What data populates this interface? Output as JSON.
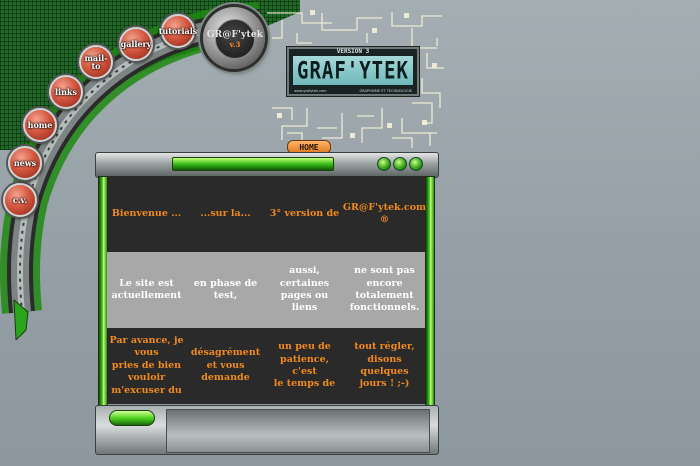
{
  "nav": {
    "buttons": [
      {
        "id": "cv",
        "label": "c.v."
      },
      {
        "id": "news",
        "label": "news"
      },
      {
        "id": "home",
        "label": "home"
      },
      {
        "id": "links",
        "label": "links"
      },
      {
        "id": "mailto",
        "label": "mail-to"
      },
      {
        "id": "gallery",
        "label": "gallery"
      },
      {
        "id": "tutorials",
        "label": "tutorials"
      }
    ],
    "disc_brand": "GR@F'ytek",
    "disc_version": "v.3"
  },
  "logo": {
    "version_text": "VERSION 3",
    "title": "GRAF'YTEK",
    "url": "www.grafytek.com",
    "tagline": "GRAPHISME ET TECHNOLOGIE"
  },
  "home_button": "HOME",
  "content": {
    "rows": [
      {
        "style": "dark",
        "cells": [
          "Bienvenue ...",
          "...sur la...",
          "3° version de",
          "GR@F'ytek.com ®"
        ]
      },
      {
        "style": "light",
        "cells": [
          "Le site est\nactuellement",
          "en phase de\ntest,",
          "aussi,\ncertaines\npages ou liens",
          "ne sont pas encore\ntotalement\nfonctionnels."
        ]
      },
      {
        "style": "dark",
        "cells": [
          "Par avance, je vous\npries de bien vouloir\nm'excuser du",
          "désagrément\net vous\ndemande",
          "un peu de\npatience, c'est\nle temps de",
          "tout régler, disons\nquelques jours ! ;-)"
        ]
      }
    ]
  },
  "colors": {
    "accent_green": "#3bbf19",
    "text_orange": "#f28a1e",
    "button_red": "#d4573f"
  }
}
